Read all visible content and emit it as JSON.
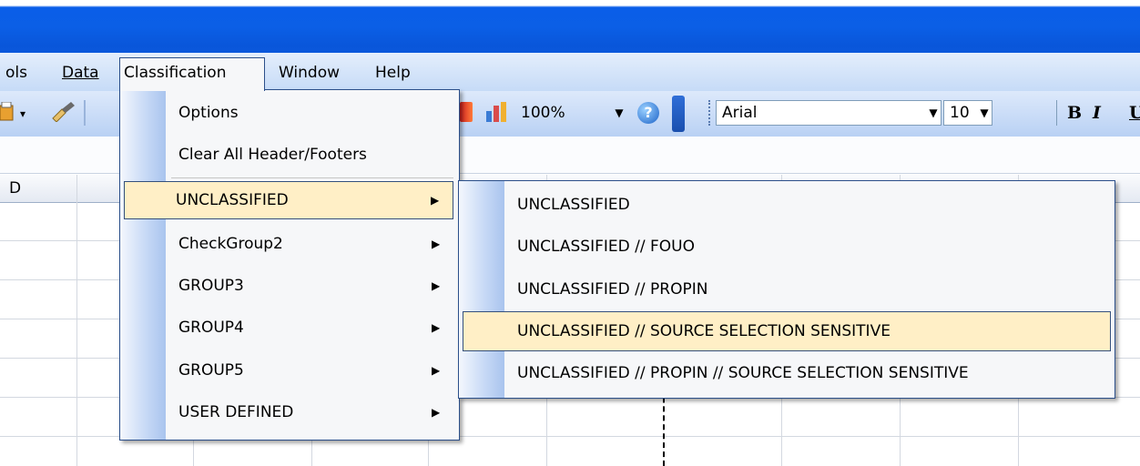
{
  "menubar": {
    "items": [
      {
        "label": "ols"
      },
      {
        "label": "Data"
      },
      {
        "label": "Classification"
      },
      {
        "label": "Window"
      },
      {
        "label": "Help"
      }
    ]
  },
  "toolbar": {
    "zoom_value": "100%",
    "font_name": "Arial",
    "font_size": "10",
    "bold_label": "B",
    "italic_label": "I",
    "underline_label": "U",
    "help_glyph": "?",
    "icons": [
      "paint-icon",
      "brush-icon",
      "book-icon",
      "chart-wizard-icon",
      "help-icon"
    ]
  },
  "sheet": {
    "column_label_d": "D"
  },
  "classification_menu": {
    "items": [
      {
        "label": "Options"
      },
      {
        "label": "Clear All Header/Footers"
      },
      {
        "label": "UNCLASSIFIED",
        "submenu": true,
        "highlighted": true
      },
      {
        "label": "CheckGroup2",
        "submenu": true
      },
      {
        "label": "GROUP3",
        "submenu": true
      },
      {
        "label": "GROUP4",
        "submenu": true
      },
      {
        "label": "GROUP5",
        "submenu": true
      },
      {
        "label": "USER DEFINED",
        "submenu": true
      }
    ]
  },
  "unclassified_submenu": {
    "items": [
      {
        "label": "UNCLASSIFIED"
      },
      {
        "label": "UNCLASSIFIED // FOUO"
      },
      {
        "label": "UNCLASSIFIED // PROPIN"
      },
      {
        "label": "UNCLASSIFIED // SOURCE SELECTION SENSITIVE",
        "highlighted": true
      },
      {
        "label": "UNCLASSIFIED // PROPIN // SOURCE SELECTION SENSITIVE"
      }
    ]
  },
  "colors": {
    "titlebar": "#0a5ee8",
    "menu_highlight": "#ffefc6",
    "menu_border": "#2b4f8a"
  }
}
